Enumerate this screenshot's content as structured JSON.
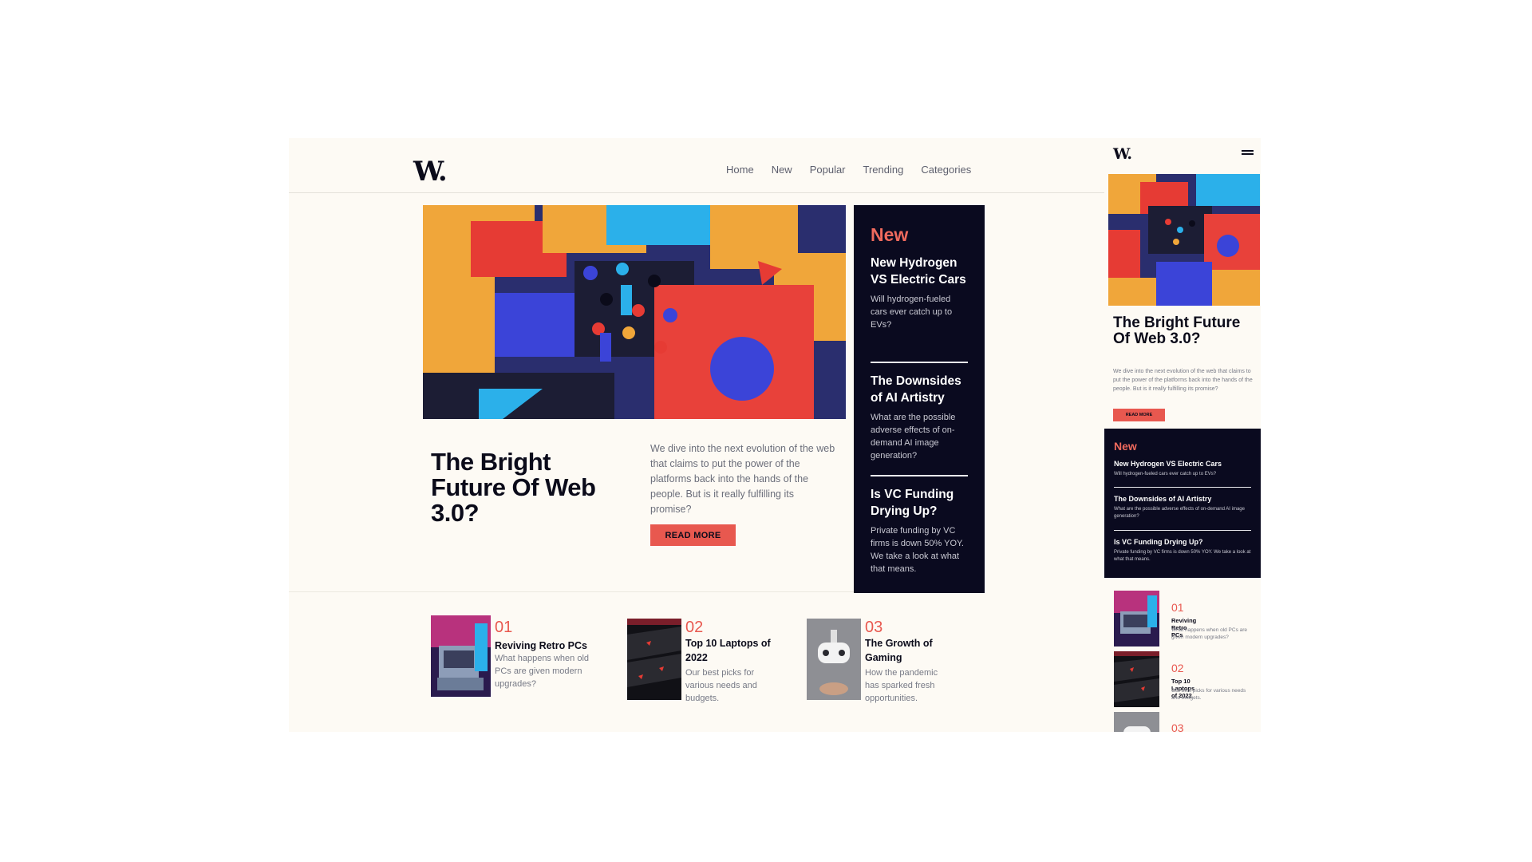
{
  "site": {
    "logo": "W."
  },
  "nav": [
    "Home",
    "New",
    "Popular",
    "Trending",
    "Categories"
  ],
  "hero": {
    "title": "The Bright Future Of Web 3.0?",
    "description": "We dive into the next evolution of the web that claims to put the power of the platforms back into the hands of the people. But is it really fulfilling its promise?",
    "button": "READ MORE"
  },
  "new_panel": {
    "heading": "New",
    "items": [
      {
        "title": "New Hydrogen VS Electric Cars",
        "description": "Will hydrogen-fueled cars ever catch up to EVs?"
      },
      {
        "title": "The Downsides of AI Artistry",
        "description": "What are the possible adverse effects of on-demand AI image generation?"
      },
      {
        "title": "Is VC Funding Drying Up?",
        "description": "Private funding by VC firms is down 50% YOY. We take a look at what that means."
      }
    ]
  },
  "cards": [
    {
      "number": "01",
      "title": "Reviving Retro PCs",
      "description": "What happens when old PCs are given modern upgrades?"
    },
    {
      "number": "02",
      "title": "Top 10 Laptops of 2022",
      "description": "Our best picks for various needs and budgets."
    },
    {
      "number": "03",
      "title": "The Growth of Gaming",
      "description": "How the pandemic has sparked fresh opportunities."
    }
  ],
  "colors": {
    "accent": "#e8584f",
    "dark": "#0a0a1f",
    "background": "#fdfaf4"
  }
}
